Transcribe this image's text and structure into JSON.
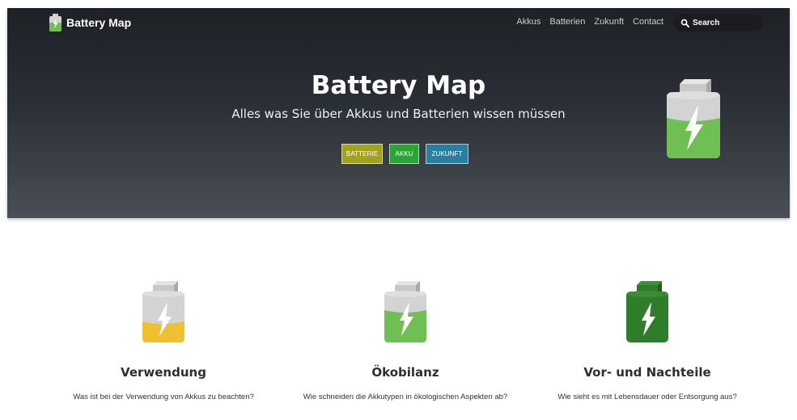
{
  "navbar": {
    "brand": "Battery Map",
    "links": [
      "Akkus",
      "Batterien",
      "Zukunft",
      "Contact"
    ],
    "search_placeholder": "Search"
  },
  "hero": {
    "title": "Battery Map",
    "subtitle": "Alles was Sie über Akkus und Batterien wissen müssen",
    "buttons": [
      "BATTERIE",
      "AKKU",
      "ZUKUNFT"
    ]
  },
  "features": [
    {
      "title": "Verwendung",
      "text": "Was ist bei der Verwendung von Akkus zu beachten?",
      "icon": "battery-yellow-icon",
      "fill_color": "#f0c030",
      "fill_level": 0.4
    },
    {
      "title": "Ökobilanz",
      "text": "Wie schneiden die Akkutypen in ökologischen Aspekten ab?",
      "icon": "battery-green-icon",
      "fill_color": "#6fbf55",
      "fill_level": 0.6
    },
    {
      "title": "Vor- und Nachteile",
      "text": "Wie sieht es mit Lebensdauer oder Entsorgung aus?",
      "icon": "battery-darkgreen-icon",
      "fill_color": "#2f7d2a",
      "fill_level": 1.0
    }
  ],
  "colors": {
    "batterie_button": "#a3a21c",
    "akku_button": "#2aa534",
    "zukunft_button": "#277fa2",
    "hero_battery_fill": "#6fbf55"
  }
}
